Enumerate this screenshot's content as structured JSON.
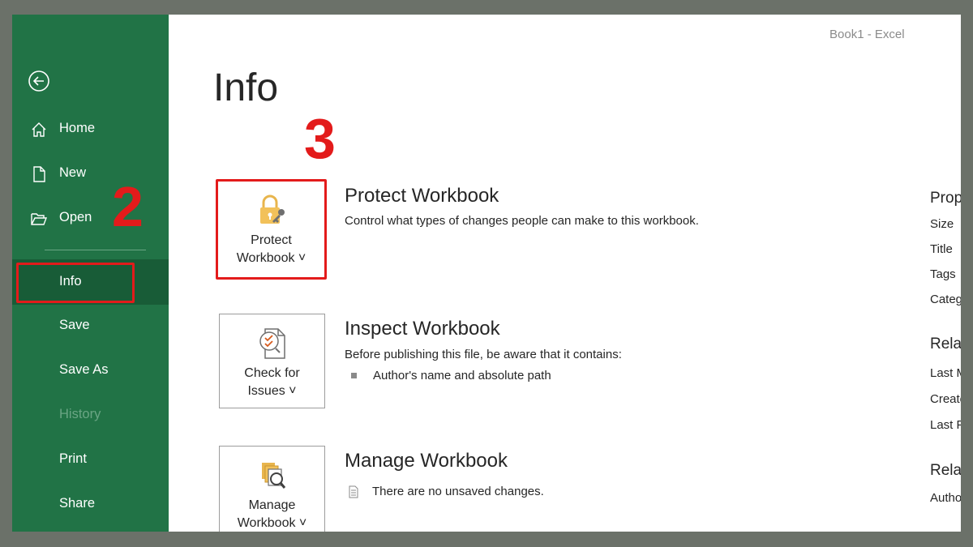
{
  "window_title": "Book1  -  Excel",
  "sidebar": {
    "items": [
      {
        "label": "Home",
        "icon": "home-icon"
      },
      {
        "label": "New",
        "icon": "new-document-icon"
      },
      {
        "label": "Open",
        "icon": "open-folder-icon"
      },
      {
        "label": "Info",
        "active": true
      },
      {
        "label": "Save"
      },
      {
        "label": "Save As"
      },
      {
        "label": "History",
        "disabled": true
      },
      {
        "label": "Print"
      },
      {
        "label": "Share"
      }
    ]
  },
  "annotations": {
    "step2": "2",
    "step3": "3"
  },
  "page_title": "Info",
  "sections": [
    {
      "button_label_line1": "Protect",
      "button_label_line2": "Workbook ˅",
      "title": "Protect Workbook",
      "description": "Control what types of changes people can make to this workbook."
    },
    {
      "button_label_line1": "Check for",
      "button_label_line2": "Issues ˅",
      "title": "Inspect Workbook",
      "description": "Before publishing this file, be aware that it contains:",
      "bullets": [
        "Author's name and absolute path"
      ]
    },
    {
      "button_label_line1": "Manage",
      "button_label_line2": "Workbook ˅",
      "title": "Manage Workbook",
      "note": "There are no unsaved changes."
    }
  ],
  "properties_panel": {
    "heading1": "Properties",
    "items1": [
      "Size",
      "Title",
      "Tags",
      "Categories"
    ],
    "heading2": "Related Dates",
    "items2": [
      "Last Modified",
      "Created",
      "Last Printed"
    ],
    "heading3": "Related People",
    "items3": [
      "Author"
    ]
  },
  "colors": {
    "sidebar": "#217346",
    "sidebar_active": "#185c37",
    "annotation": "#e31b1b"
  }
}
